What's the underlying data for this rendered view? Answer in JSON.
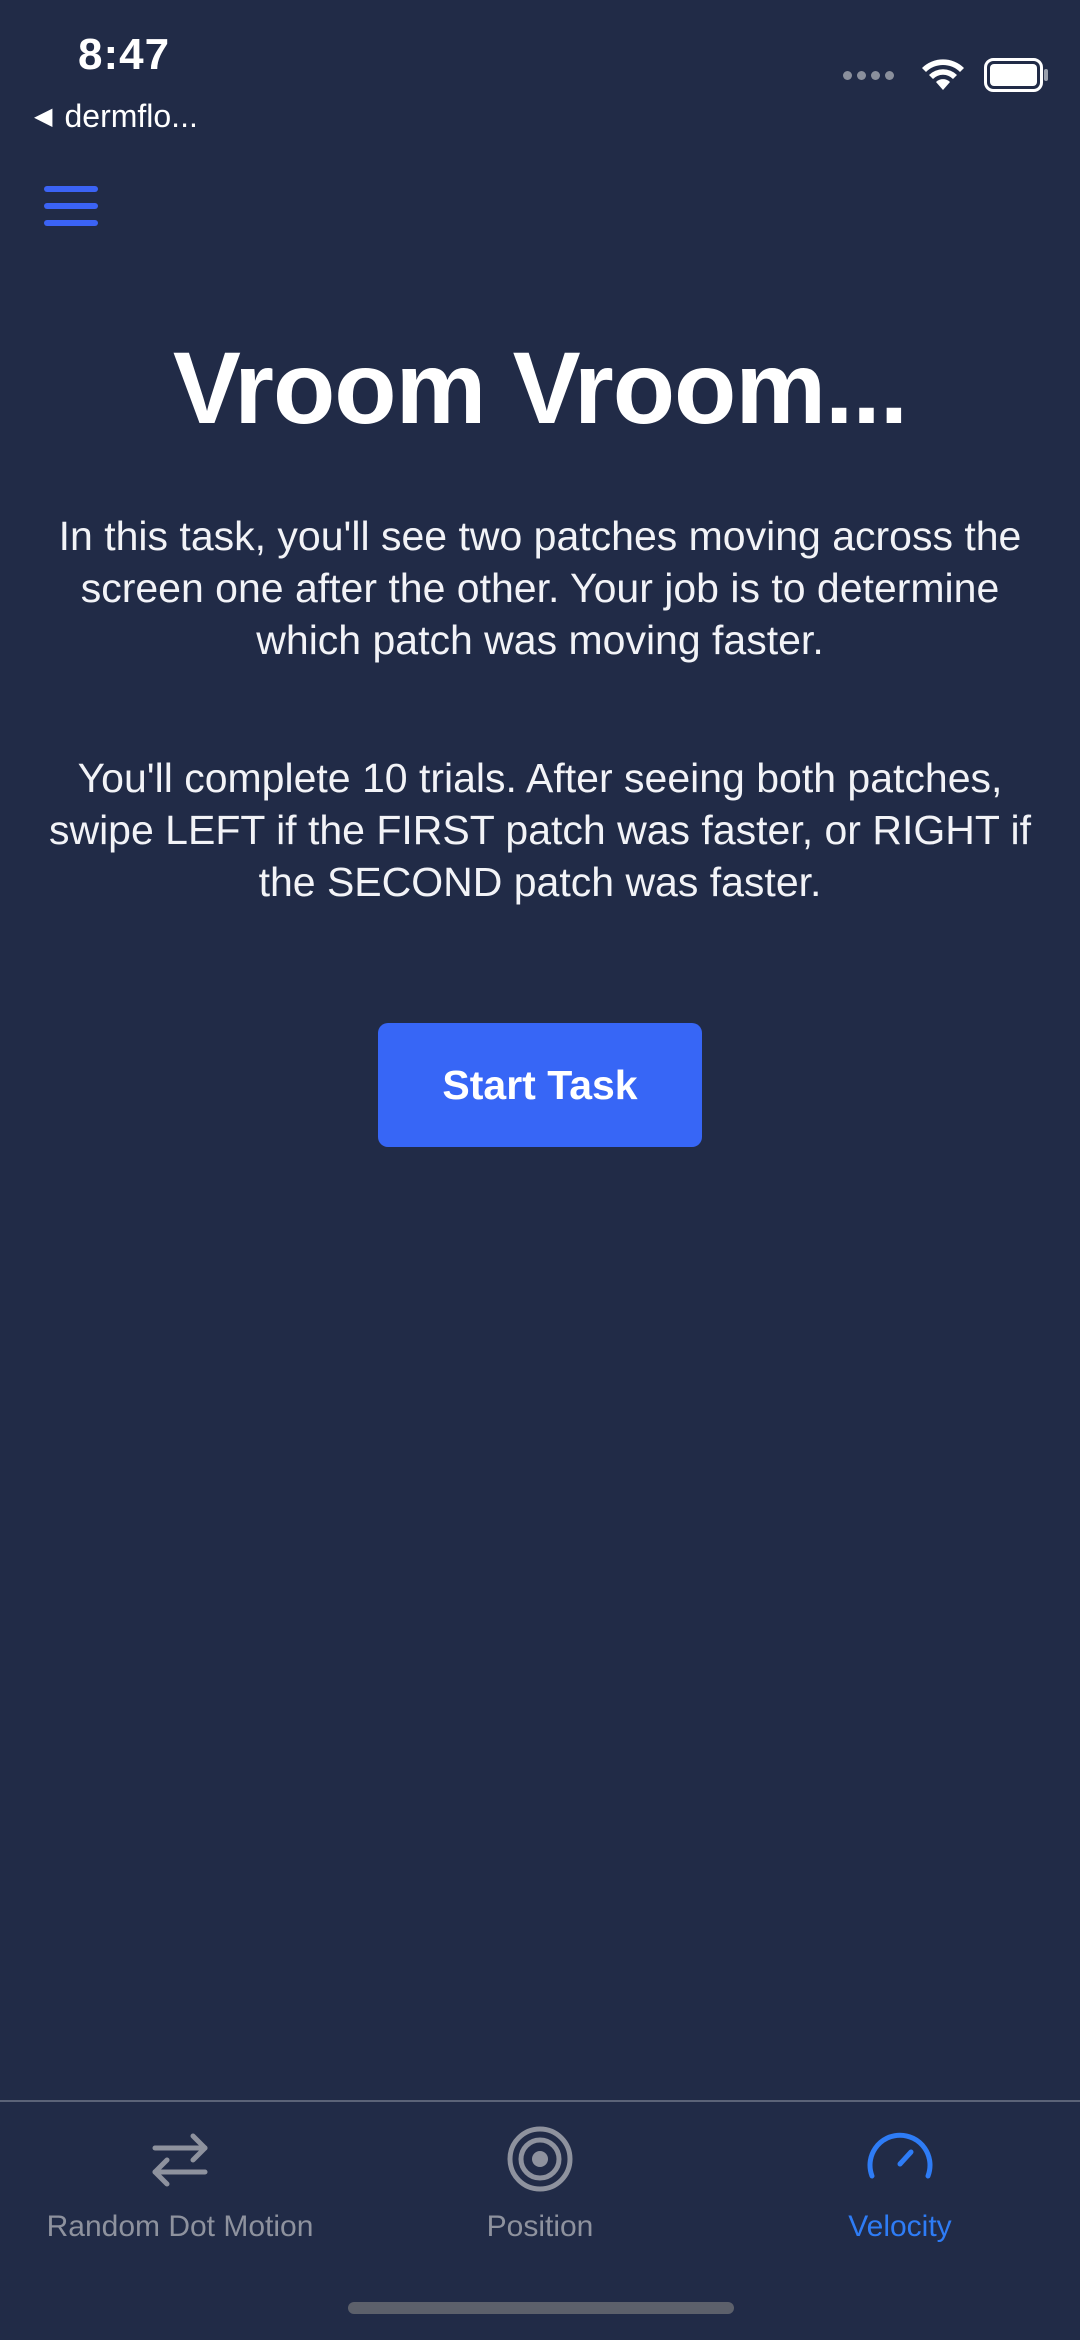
{
  "status_bar": {
    "time": "8:47",
    "back_label": "dermflo..."
  },
  "header": {
    "menu_icon": "hamburger-icon"
  },
  "main": {
    "title": "Vroom Vroom...",
    "paragraph_1": "In this task, you'll see two patches moving across the screen one after the other. Your job is to determine which patch was moving faster.",
    "paragraph_2": "You'll complete 10 trials. After seeing both patches, swipe LEFT if the FIRST patch was faster, or RIGHT if the SECOND patch was faster.",
    "start_button_label": "Start Task"
  },
  "tabs": [
    {
      "label": "Random Dot Motion",
      "icon": "arrows-swap-icon",
      "active": false
    },
    {
      "label": "Position",
      "icon": "target-icon",
      "active": false
    },
    {
      "label": "Velocity",
      "icon": "speedometer-icon",
      "active": true
    }
  ],
  "colors": {
    "background": "#212b47",
    "accent": "#3766f6",
    "active_tab": "#2e7cf6",
    "inactive_tab": "#8e929e"
  }
}
